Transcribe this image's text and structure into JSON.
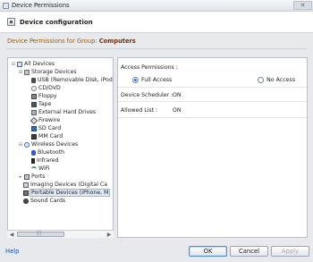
{
  "window": {
    "title": "Device Permissions",
    "close_symbol": "✕"
  },
  "header": {
    "title": "Device configuration"
  },
  "group": {
    "label": "Device Permissions for Group:",
    "name": "Computers"
  },
  "tree": {
    "items": [
      {
        "label": "All Devices",
        "expander": "⊟",
        "icon": "computer-icon"
      },
      {
        "label": "Storage Devices",
        "expander": "⊟",
        "icon": "storage-icon"
      },
      {
        "label": "USB (Removable Disk, iPod",
        "expander": "",
        "icon": "usb-icon"
      },
      {
        "label": "CD/DVD",
        "expander": "",
        "icon": "cd-icon"
      },
      {
        "label": "Floppy",
        "expander": "",
        "icon": "floppy-icon"
      },
      {
        "label": "Tape",
        "expander": "",
        "icon": "tape-icon"
      },
      {
        "label": "External Hard Drives",
        "expander": "",
        "icon": "hard-drive-icon"
      },
      {
        "label": "Firewire",
        "expander": "",
        "icon": "firewire-icon"
      },
      {
        "label": "SD Card",
        "expander": "",
        "icon": "sd-card-icon"
      },
      {
        "label": "MM Card",
        "expander": "",
        "icon": "mm-card-icon"
      },
      {
        "label": "Wireless Devices",
        "expander": "⊟",
        "icon": "wireless-icon"
      },
      {
        "label": "Bluetooth",
        "expander": "",
        "icon": "bluetooth-icon"
      },
      {
        "label": "Infrared",
        "expander": "",
        "icon": "infrared-icon"
      },
      {
        "label": "WiFi",
        "expander": "",
        "icon": "wifi-icon"
      },
      {
        "label": "Ports",
        "expander": "▸",
        "icon": "ports-icon"
      },
      {
        "label": "Imaging Devices (Digital Ca",
        "expander": "",
        "icon": "imaging-icon"
      },
      {
        "label": "Portable Devices (iPhone, M",
        "expander": "",
        "icon": "portable-device-icon"
      },
      {
        "label": "Sound Cards",
        "expander": "",
        "icon": "sound-card-icon"
      }
    ],
    "selected_index": 16
  },
  "scrollbar": {
    "left_arrow": "◀",
    "right_arrow": "▶"
  },
  "properties": {
    "access_permissions_label": "Access Permissions :",
    "full_access_label": "Full Access",
    "no_access_label": "No Access",
    "device_scheduler_label": "Device Scheduler :",
    "device_scheduler_value": "ON",
    "allowed_list_label": "Allowed List :",
    "allowed_list_value": "ON"
  },
  "footer": {
    "help": "Help",
    "ok": "OK",
    "cancel": "Cancel",
    "apply": "Apply"
  },
  "colors": {
    "background": "#e7e9ec",
    "accent_blue": "#2f6fd2",
    "group_label": "#9b5d00",
    "group_name": "#7a2c05"
  }
}
